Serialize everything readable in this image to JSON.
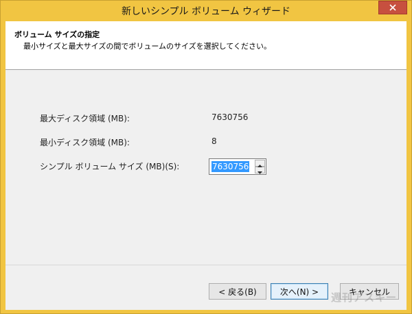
{
  "window": {
    "title": "新しいシンプル ボリューム ウィザード"
  },
  "header": {
    "title": "ボリューム サイズの指定",
    "subtitle": "最小サイズと最大サイズの間でボリュームのサイズを選択してください。"
  },
  "fields": {
    "max_label": "最大ディスク領域 (MB):",
    "max_value": "7630756",
    "min_label": "最小ディスク領域 (MB):",
    "min_value": "8",
    "size_label": "シンプル ボリューム サイズ (MB)(S):",
    "size_value": "7630756"
  },
  "buttons": {
    "back": "< 戻る(B)",
    "next": "次へ(N) >",
    "cancel": "キャンセル"
  },
  "watermark": "週刊アスキー",
  "icons": {
    "close": "close-icon",
    "spin_up": "arrow-up-icon",
    "spin_down": "arrow-down-icon"
  },
  "colors": {
    "titlebar": "#f1c542",
    "close_button": "#c7503f",
    "selection": "#3399ff"
  }
}
